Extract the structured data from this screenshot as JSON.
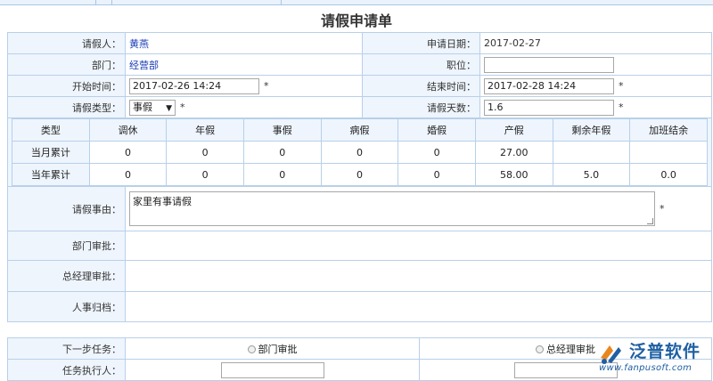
{
  "form": {
    "title": "请假申请单",
    "applicant": {
      "label": "请假人：",
      "value": "黄燕"
    },
    "apply_date": {
      "label": "申请日期：",
      "value": "2017-02-27"
    },
    "department": {
      "label": "部门：",
      "value": "经营部"
    },
    "position": {
      "label": "职位：",
      "value": ""
    },
    "start_time": {
      "label": "开始时间：",
      "value": "2017-02-26 14:24",
      "required": "*"
    },
    "end_time": {
      "label": "结束时间：",
      "value": "2017-02-28 14:24",
      "required": "*"
    },
    "leave_type": {
      "label": "请假类型：",
      "value": "事假",
      "required": "*"
    },
    "leave_days": {
      "label": "请假天数：",
      "value": "1.6",
      "required": "*"
    },
    "reason": {
      "label": "请假事由：",
      "value": "家里有事请假",
      "required": "*"
    },
    "dept_approval": {
      "label": "部门审批："
    },
    "gm_approval": {
      "label": "总经理审批："
    },
    "hr_archive": {
      "label": "人事归档："
    }
  },
  "stats": {
    "headers": [
      "类型",
      "调休",
      "年假",
      "事假",
      "病假",
      "婚假",
      "产假",
      "剩余年假",
      "加班结余"
    ],
    "rows": [
      {
        "label": "当月累计",
        "values": [
          "0",
          "0",
          "0",
          "0",
          "0",
          "27.00",
          "",
          ""
        ]
      },
      {
        "label": "当年累计",
        "values": [
          "0",
          "0",
          "0",
          "0",
          "0",
          "58.00",
          "5.0",
          "0.0"
        ]
      }
    ]
  },
  "next_step": {
    "label": "下一步任务：",
    "options": [
      "部门审批",
      "总经理审批"
    ],
    "executor_label": "任务执行人："
  },
  "watermark": {
    "brand": "泛普软件",
    "url": "www.fanpusoft.com"
  }
}
